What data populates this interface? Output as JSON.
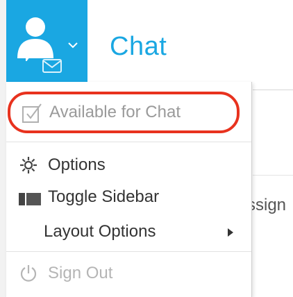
{
  "header": {
    "title": "Chat",
    "accent_color": "#1aa7e2",
    "user_icon": "user-icon",
    "badge_icon": "mail-icon",
    "caret_icon": "chevron-down-icon"
  },
  "background": {
    "partial_text": "ssign"
  },
  "menu": {
    "items": [
      {
        "label": "Available for Chat",
        "icon": "checkbox-icon",
        "enabled": false,
        "highlighted": true,
        "highlight_color": "#e8321e"
      },
      {
        "label": "Options",
        "icon": "gear-icon",
        "enabled": true
      },
      {
        "label": "Toggle Sidebar",
        "icon": "sidebar-icon",
        "enabled": true
      },
      {
        "label": "Layout Options",
        "icon": "chevron-right-icon",
        "enabled": true,
        "has_submenu": true
      },
      {
        "label": "Sign Out",
        "icon": "power-icon",
        "enabled": false
      }
    ]
  }
}
